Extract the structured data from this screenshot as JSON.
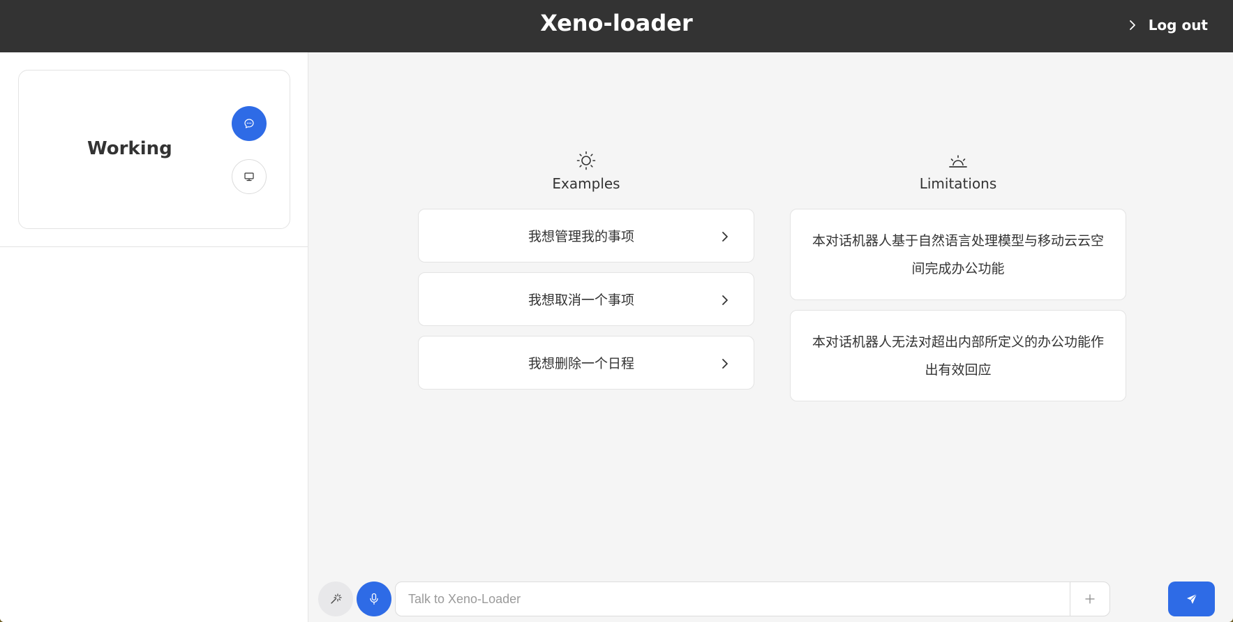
{
  "header": {
    "title": "Xeno-loader",
    "logout_label": "Log out"
  },
  "sidebar": {
    "mode_card": {
      "title": "Working",
      "buttons": [
        {
          "icon": "chat-bubble-icon",
          "active": true
        },
        {
          "icon": "monitor-icon",
          "active": false
        }
      ]
    }
  },
  "main": {
    "examples": {
      "title": "Examples",
      "icon": "sun-icon",
      "items": [
        "我想管理我的事项",
        "我想取消一个事项",
        "我想删除一个日程"
      ]
    },
    "limitations": {
      "title": "Limitations",
      "icon": "sunset-icon",
      "items": [
        "本对话机器人基于自然语言处理模型与移动云云空间完成办公功能",
        "本对话机器人无法对超出内部所定义的办公功能作出有效回应"
      ]
    }
  },
  "input_bar": {
    "placeholder": "Talk to Xeno-Loader",
    "value": ""
  },
  "colors": {
    "header_bg": "#333333",
    "accent": "#2e6be6",
    "page_bg": "#f5f5f5"
  }
}
